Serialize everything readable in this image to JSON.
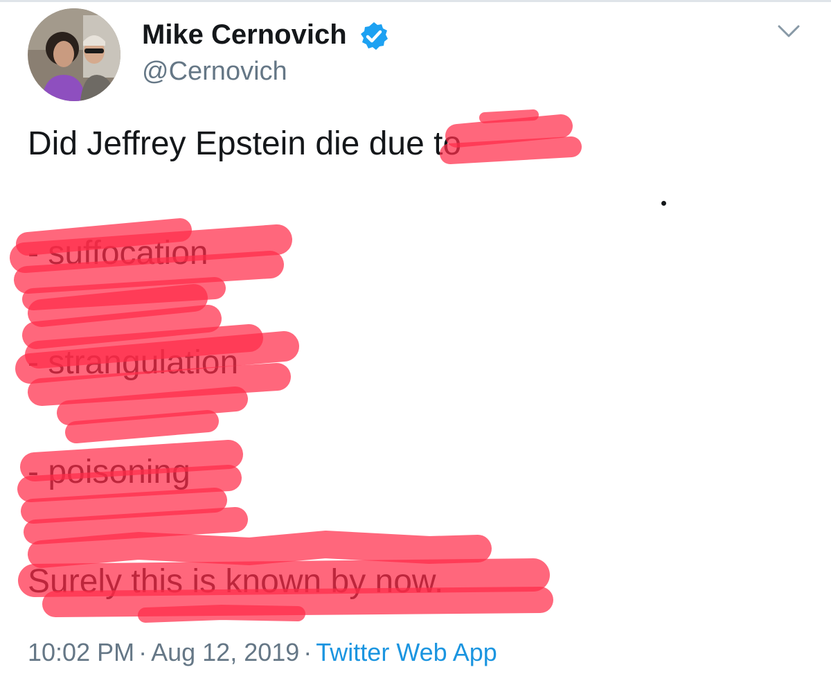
{
  "tweet": {
    "author": {
      "display_name": "Mike Cernovich",
      "handle": "@Cernovich",
      "verified": true,
      "avatar_icon": "avatar-photo"
    },
    "menu_icon": "chevron-down-icon",
    "text_lines": [
      "Did Jeffrey Epstein die due to",
      "- suffocation",
      "- strangulation",
      "- poisoning",
      "Surely this is known by now."
    ],
    "time": "10:02 PM",
    "date": "Aug 12, 2019",
    "separator": "·",
    "source": "Twitter Web App"
  },
  "colors": {
    "text": "#14171a",
    "secondary_text": "#657786",
    "link": "#1b95e0",
    "verified_badge": "#1da1f2",
    "highlighter": "#ff2d4a"
  }
}
